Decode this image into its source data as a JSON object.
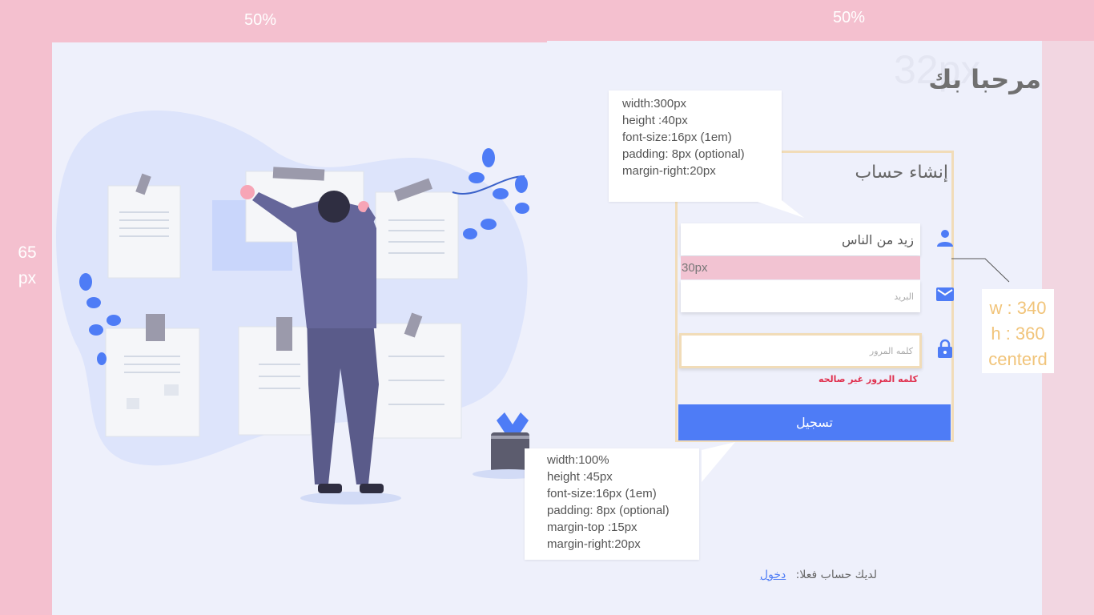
{
  "annotations": {
    "left_half": "50%",
    "right_half": "50%",
    "side_top": "65",
    "side_bottom": "px",
    "heading_size": "32px",
    "field_gap": "30px",
    "size_w": "w : 340",
    "size_h": "h : 360",
    "size_pos": "centerd"
  },
  "heading": "مرحبا بك",
  "form": {
    "title": "إنشاء حساب",
    "name_value": "زيد من الناس",
    "email_placeholder": "البريد",
    "password_placeholder": "كلمه المرور",
    "error": "كلمه المرور غير صالحه",
    "submit": "تسجيل"
  },
  "callouts": {
    "input": [
      "width:300px",
      "height :40px",
      "font-size:16px (1em)",
      "padding: 8px (optional)",
      "margin-right:20px"
    ],
    "button": [
      "width:100%",
      "height :45px",
      "font-size:16px (1em)",
      "padding: 8px (optional)",
      "margin-top :15px",
      "margin-right:20px"
    ]
  },
  "footer": {
    "prompt": "لديك حساب فعلا:",
    "link": "دخول"
  },
  "colors": {
    "band": "#f4c0cf",
    "canvas": "#eef0fb",
    "accent": "#4e7cf6",
    "card_border": "#f1dcb8",
    "error": "#e0304e",
    "size_text": "#f1c47a"
  },
  "icons": [
    "user-icon",
    "mail-icon",
    "lock-icon"
  ]
}
